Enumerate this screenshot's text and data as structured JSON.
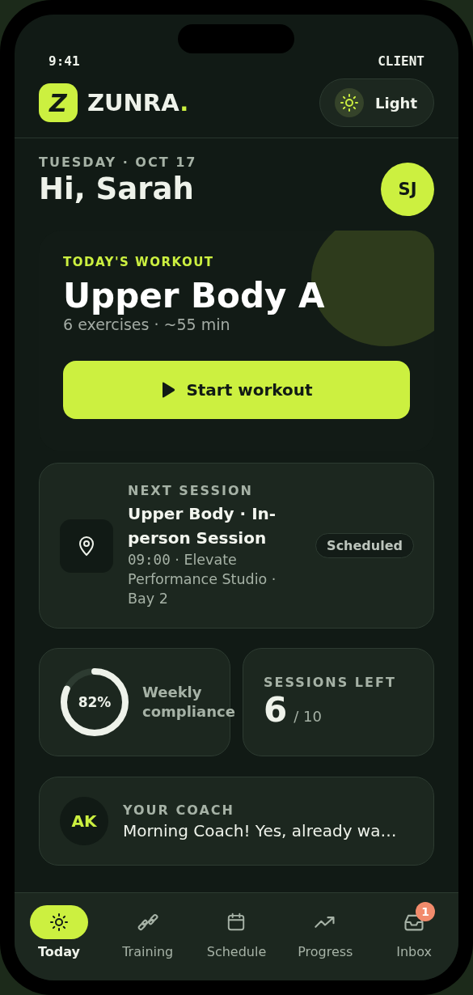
{
  "status_bar": {
    "time": "9:41",
    "role": "CLIENT"
  },
  "header": {
    "logo_mark": "Z",
    "brand": "ZUNRA",
    "brand_dot": ".",
    "theme_toggle": {
      "label": "Light"
    }
  },
  "greeting": {
    "date": "TUESDAY · OCT 17",
    "title": "Hi, Sarah",
    "avatar": "SJ"
  },
  "workout": {
    "eyebrow": "TODAY'S WORKOUT",
    "title": "Upper Body A",
    "subtitle": "6 exercises · ~55 min",
    "button": "Start workout"
  },
  "next_session": {
    "eyebrow": "NEXT SESSION",
    "title": "Upper Body · In-person Session",
    "time": "09:00",
    "place": " · Elevate Performance Studio · Bay 2",
    "status": "Scheduled"
  },
  "compliance": {
    "value": "82%",
    "label": "Weekly compliance"
  },
  "sessions_left": {
    "label": "SESSIONS LEFT",
    "count": "6",
    "total": "/ 10"
  },
  "coach": {
    "avatar": "AK",
    "label": "YOUR COACH",
    "message": "Morning Coach! Yes, already wa…"
  },
  "nav": [
    {
      "kind": "today",
      "label": "Today",
      "selected": true
    },
    {
      "kind": "training",
      "label": "Training",
      "selected": false
    },
    {
      "kind": "schedule",
      "label": "Schedule",
      "selected": false
    },
    {
      "kind": "progress",
      "label": "Progress",
      "selected": false
    },
    {
      "kind": "inbox",
      "label": "Inbox",
      "selected": false,
      "badge": "1"
    }
  ]
}
